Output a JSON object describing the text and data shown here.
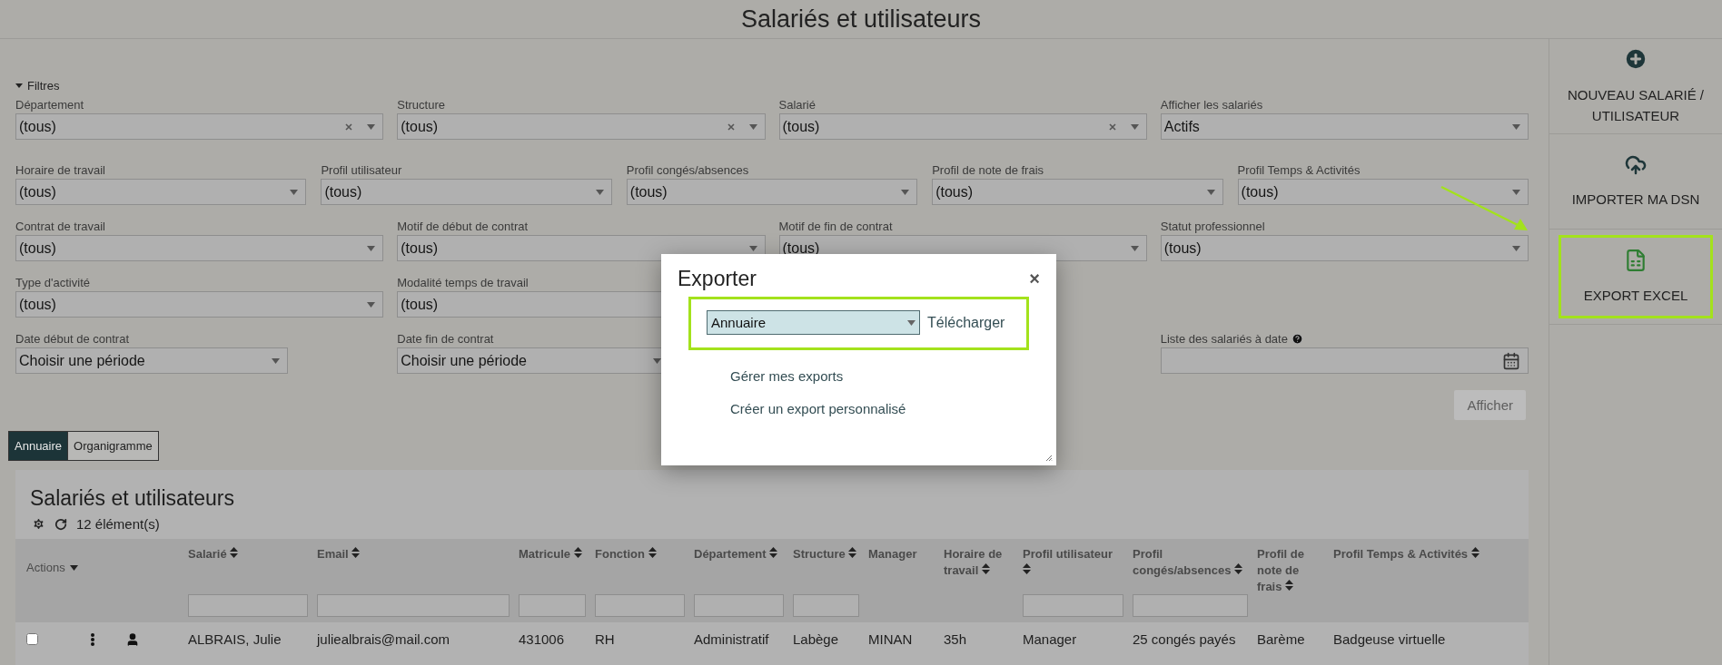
{
  "title": "Salariés et utilisateurs",
  "filters": {
    "label": "Filtres",
    "expanded": true,
    "rows": [
      [
        {
          "label": "Département",
          "value": "(tous)",
          "kind": "clearable"
        },
        {
          "label": "Structure",
          "value": "(tous)",
          "kind": "clearable"
        },
        {
          "label": "Salarié",
          "value": "(tous)",
          "kind": "clearable"
        },
        {
          "label": "Afficher les salariés",
          "value": "Actifs",
          "kind": "select"
        }
      ],
      [
        {
          "label": "Horaire de travail",
          "value": "(tous)",
          "kind": "select"
        },
        {
          "label": "Profil utilisateur",
          "value": "(tous)",
          "kind": "select"
        },
        {
          "label": "Profil congés/absences",
          "value": "(tous)",
          "kind": "select"
        },
        {
          "label": "Profil de note de frais",
          "value": "(tous)",
          "kind": "select"
        },
        {
          "label": "Profil Temps & Activités",
          "value": "(tous)",
          "kind": "select"
        }
      ],
      [
        {
          "label": "Contrat de travail",
          "value": "(tous)",
          "kind": "select"
        },
        {
          "label": "Motif de début de contrat",
          "value": "(tous)",
          "kind": "select"
        },
        {
          "label": "Motif de fin de contrat",
          "value": "(tous)",
          "kind": "select"
        },
        {
          "label": "Statut professionnel",
          "value": "(tous)",
          "kind": "select"
        }
      ],
      [
        {
          "label": "Type d'activité",
          "value": "(tous)",
          "kind": "select"
        },
        {
          "label": "Modalité temps de travail",
          "value": "(tous)",
          "kind": "select"
        }
      ],
      [
        {
          "label": "Date début de contrat",
          "value": "Choisir une période",
          "kind": "period"
        },
        {
          "label": "Date fin de contrat",
          "value": "Choisir une période",
          "kind": "period"
        },
        "",
        {
          "label": "Liste des salariés à date",
          "kind": "date"
        }
      ]
    ]
  },
  "show_button": {
    "label": "Afficher",
    "disabled": true
  },
  "view_tabs": [
    {
      "label": "Annuaire",
      "selected": true
    },
    {
      "label": "Organigramme",
      "selected": false
    }
  ],
  "table": {
    "title": "Salariés et utilisateurs",
    "count": "12 élément(s)",
    "columns": [
      {
        "label": "Actions",
        "kind": "menu"
      },
      {
        "label": "Salarié",
        "kind": "filter"
      },
      {
        "label": "Email",
        "kind": "filter"
      },
      {
        "label": "Matricule",
        "kind": "filter"
      },
      {
        "label": "Fonction",
        "kind": "filter"
      },
      {
        "label": "Département",
        "kind": "filter"
      },
      {
        "label": "Structure",
        "kind": "filter"
      },
      {
        "label": "Manager",
        "kind": "plain"
      },
      {
        "label": "Horaire de travail",
        "kind": "sort"
      },
      {
        "label": "Profil utilisateur",
        "kind": "filter"
      },
      {
        "label": "Profil congés/absences",
        "kind": "filter"
      },
      {
        "label": "Profil de note de frais",
        "kind": "sort"
      },
      {
        "label": "Profil Temps & Activités",
        "kind": "sort"
      }
    ],
    "rows": [
      {
        "checked": false,
        "cells": [
          "",
          "ALBRAIS, Julie",
          "juliealbrais@mail.com",
          "431006",
          "RH",
          "Administratif",
          "Labège",
          "MINAN",
          "35h",
          "Manager",
          "25 congés payés",
          "Barème",
          "Badgeuse virtuelle"
        ]
      }
    ]
  },
  "side_actions": [
    {
      "label": "NOUVEAU SALARIÉ / UTILISATEUR",
      "kind": "add",
      "highlighted": false
    },
    {
      "label": "IMPORTER MA DSN",
      "kind": "upload",
      "highlighted": false
    },
    {
      "label": "EXPORT EXCEL",
      "kind": "excel",
      "highlighted": true
    }
  ],
  "modal": {
    "title": "Exporter",
    "close": "×",
    "select_value": "Annuaire",
    "download": "Télécharger",
    "highlighted": true,
    "links": [
      "Gérer mes exports",
      "Créer un export personnalisé"
    ]
  }
}
